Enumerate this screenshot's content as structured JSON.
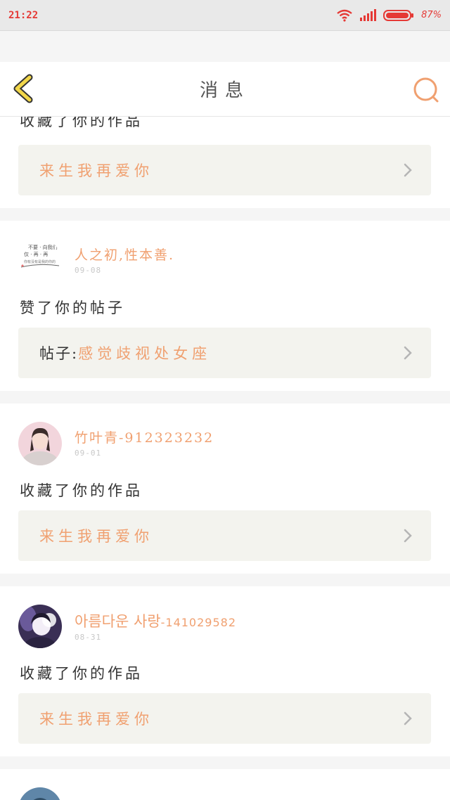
{
  "status_bar": {
    "time": "21:22",
    "battery": "87%",
    "accent_color": "#e53935"
  },
  "header": {
    "title": "消息",
    "back_icon": "chevron-left-icon",
    "search_icon": "search-icon"
  },
  "notifications": [
    {
      "action": "收藏了你的作品",
      "target": "来生我再爱你"
    },
    {
      "username": "人之初,性本善.",
      "date": "09-08",
      "action": "赞了你的帖子",
      "target_prefix": "帖子:",
      "target": "感觉歧视处女座"
    },
    {
      "username": "竹叶青-912323232",
      "date": "09-01",
      "action": "收藏了你的作品",
      "target": "来生我再爱你"
    },
    {
      "username": "아름다운 사랑",
      "username_suffix": "-141029582",
      "date": "08-31",
      "action": "收藏了你的作品",
      "target": "来生我再爱你"
    }
  ],
  "colors": {
    "accent": "#f0a070",
    "back_icon": "#f2d74a",
    "card_target_bg": "#f3f3ee"
  }
}
